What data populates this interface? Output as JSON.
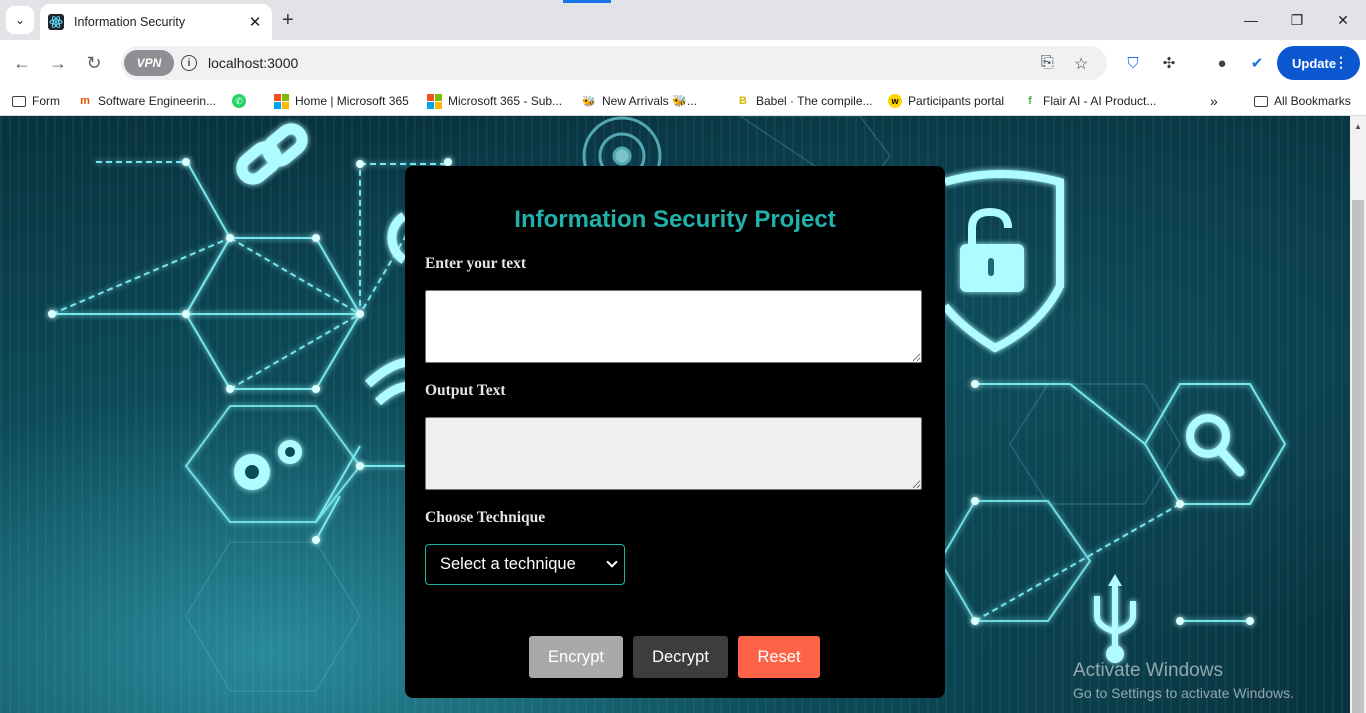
{
  "browser": {
    "tab_title": "Information Security",
    "url": "localhost:3000",
    "vpn_label": "VPN",
    "update_label": "Update",
    "colors": {
      "update_button": "#0b57d0",
      "tab_strip": "#e1e3e6"
    }
  },
  "bookmarks": [
    {
      "label": "Form",
      "icon": "folder-icon"
    },
    {
      "label": "Software Engineerin...",
      "icon": "m-logo-icon"
    },
    {
      "label": "",
      "icon": "whatsapp-icon"
    },
    {
      "label": "Home | Microsoft 365",
      "icon": "microsoft-icon"
    },
    {
      "label": "Microsoft 365 - Sub...",
      "icon": "microsoft-icon"
    },
    {
      "label": "New Arrivals 🐝...",
      "icon": "bee-icon"
    },
    {
      "label": "Babel · The compile...",
      "icon": "babel-icon"
    },
    {
      "label": "Participants portal",
      "icon": "w-logo-icon"
    },
    {
      "label": "Flair AI - AI Product...",
      "icon": "flair-icon"
    }
  ],
  "all_bookmarks": "All Bookmarks",
  "app": {
    "title": "Information Security Project",
    "input_label": "Enter your text",
    "input_value": "",
    "output_label": "Output Text",
    "output_value": "",
    "technique_label": "Choose Technique",
    "technique_selected": "Select a technique",
    "encrypt_label": "Encrypt",
    "decrypt_label": "Decrypt",
    "reset_label": "Reset",
    "colors": {
      "title": "#20b2aa",
      "encrypt": "#a9a9a9",
      "decrypt": "#3d3d3d",
      "reset": "#ff6347",
      "card": "#000000"
    }
  },
  "watermark": {
    "line1": "Activate Windows",
    "line2": "Go to Settings to activate Windows."
  }
}
